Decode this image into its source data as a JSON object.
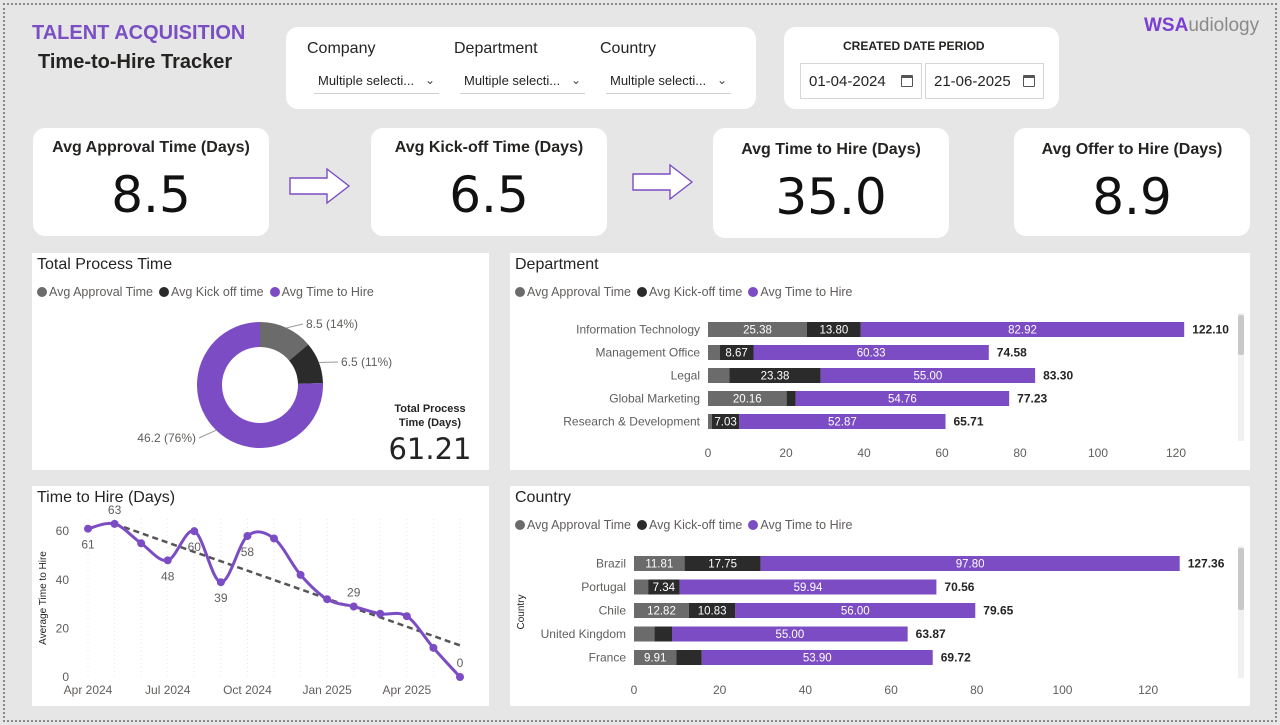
{
  "header": {
    "title_line1": "TALENT ACQUISITION",
    "title_line2": "Time-to-Hire Tracker",
    "brand_bold": "WSA",
    "brand_rest": "udiology"
  },
  "filters": {
    "company": {
      "label": "Company",
      "value": "Multiple selecti..."
    },
    "department": {
      "label": "Department",
      "value": "Multiple selecti..."
    },
    "country": {
      "label": "Country",
      "value": "Multiple selecti..."
    }
  },
  "date_period": {
    "title": "CREATED DATE PERIOD",
    "start": "01-04-2024",
    "end": "21-06-2025"
  },
  "kpis": [
    {
      "label": "Avg Approval Time (Days)",
      "value": "8.5"
    },
    {
      "label": "Avg Kick-off Time (Days)",
      "value": "6.5"
    },
    {
      "label": "Avg Time to Hire (Days)",
      "value": "35.0"
    },
    {
      "label": "Avg Offer to Hire (Days)",
      "value": "8.9"
    }
  ],
  "colors": {
    "approval": "#6b6b6b",
    "kickoff": "#2b2b2b",
    "hire": "#7b4cc4",
    "trend": "#555555"
  },
  "total_process": {
    "title": "Total Process Time",
    "legend": [
      "Avg Approval Time",
      "Avg Kick off time",
      "Avg Time to Hire"
    ],
    "total_label_1": "Total Process",
    "total_label_2": "Time (Days)",
    "total_value": "61.21"
  },
  "department_panel": {
    "title": "Department",
    "legend": [
      "Avg Approval Time",
      "Avg Kick-off time",
      "Avg Time to Hire"
    ]
  },
  "country_panel": {
    "title": "Country",
    "legend": [
      "Avg Approval Time",
      "Avg Kick-off time",
      "Avg Time to Hire"
    ]
  },
  "hire_trend_panel": {
    "title": "Time to Hire (Days)"
  },
  "chart_data": [
    {
      "type": "pie",
      "title": "Total Process Time",
      "categories": [
        "Avg Approval Time",
        "Avg Kick off time",
        "Avg Time to Hire"
      ],
      "values": [
        8.5,
        6.5,
        46.2
      ],
      "labels": [
        "8.5 (14%)",
        "6.5 (11%)",
        "46.2 (76%)"
      ],
      "donut": true
    },
    {
      "type": "bar",
      "title": "Department",
      "orientation": "horizontal",
      "stacked": true,
      "categories": [
        "Information Technology",
        "Management Office",
        "Legal",
        "Global Marketing",
        "Research & Development"
      ],
      "series": [
        {
          "name": "Avg Approval Time",
          "values": [
            25.38,
            3.0,
            5.5,
            20.16,
            1.0
          ]
        },
        {
          "name": "Avg Kick-off time",
          "values": [
            13.8,
            8.67,
            23.38,
            2.3,
            7.03
          ]
        },
        {
          "name": "Avg Time to Hire",
          "values": [
            82.92,
            60.33,
            55.0,
            54.76,
            52.87
          ]
        }
      ],
      "segment_labels": [
        [
          "25.38",
          "13.80",
          "82.92"
        ],
        [
          "",
          "8.67",
          "60.33"
        ],
        [
          "",
          "23.38",
          "55.00"
        ],
        [
          "20.16",
          "",
          "54.76"
        ],
        [
          "",
          "7.03",
          "52.87"
        ]
      ],
      "totals": [
        "122.10",
        "74.58",
        "83.30",
        "77.23",
        "65.71"
      ],
      "xlim": [
        0,
        130
      ],
      "xticks": [
        "0",
        "20",
        "40",
        "60",
        "80",
        "100",
        "120"
      ]
    },
    {
      "type": "bar",
      "title": "Country",
      "orientation": "horizontal",
      "stacked": true,
      "ylabel": "Country",
      "categories": [
        "Brazil",
        "Portugal",
        "Chile",
        "United Kingdom",
        "France"
      ],
      "series": [
        {
          "name": "Avg Approval Time",
          "values": [
            11.81,
            3.3,
            12.82,
            4.8,
            9.91
          ]
        },
        {
          "name": "Avg Kick-off time",
          "values": [
            17.75,
            7.34,
            10.83,
            4.07,
            5.91
          ]
        },
        {
          "name": "Avg Time to Hire",
          "values": [
            97.8,
            59.94,
            56.0,
            55.0,
            53.9
          ]
        }
      ],
      "segment_labels": [
        [
          "11.81",
          "17.75",
          "97.80"
        ],
        [
          "",
          "7.34",
          "59.94"
        ],
        [
          "12.82",
          "10.83",
          "56.00"
        ],
        [
          "",
          "",
          "55.00"
        ],
        [
          "9.91",
          "",
          "53.90"
        ]
      ],
      "totals": [
        "127.36",
        "70.56",
        "79.65",
        "63.87",
        "69.72"
      ],
      "xlim": [
        0,
        130
      ],
      "xticks": [
        "0",
        "20",
        "40",
        "60",
        "80",
        "100",
        "120"
      ]
    },
    {
      "type": "line",
      "title": "Time to Hire (Days)",
      "ylabel": "Average Time to Hire",
      "ylim": [
        0,
        65
      ],
      "yticks": [
        "0",
        "20",
        "40",
        "60"
      ],
      "xticks": [
        "Apr 2024",
        "Jul 2024",
        "Oct 2024",
        "Jan 2025",
        "Apr 2025"
      ],
      "x": [
        0,
        1,
        2,
        3,
        4,
        5,
        6,
        7,
        8,
        9,
        10,
        11,
        12,
        13,
        14
      ],
      "values": [
        61,
        63,
        55,
        48,
        60,
        39,
        58,
        57,
        42,
        32,
        29,
        26,
        25,
        12,
        0
      ],
      "point_labels": [
        "61",
        "63",
        "",
        "48",
        "60",
        "39",
        "58",
        "",
        "",
        "",
        "29",
        "",
        "",
        "",
        "0"
      ],
      "trend": [
        63,
        13
      ]
    }
  ]
}
